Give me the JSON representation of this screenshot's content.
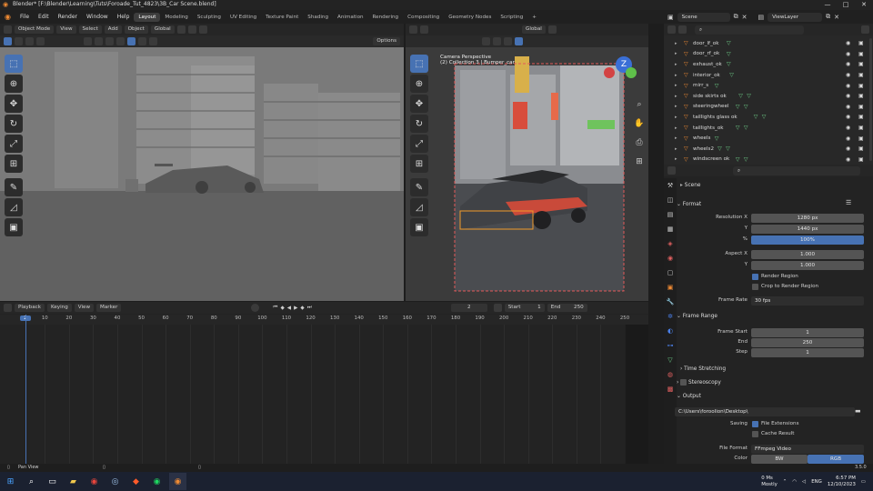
{
  "app": {
    "title": "Blender* [F:\\Blender\\Learning\\Tuts\\Foroade_Tut_4823\\3B_Car Scene.blend]",
    "window_controls": [
      "—",
      "□",
      "✕"
    ]
  },
  "menus": [
    "File",
    "Edit",
    "Render",
    "Window",
    "Help"
  ],
  "workspaces": [
    "Layout",
    "Modeling",
    "Sculpting",
    "UV Editing",
    "Texture Paint",
    "Shading",
    "Animation",
    "Rendering",
    "Compositing",
    "Geometry Nodes",
    "Scripting",
    "+"
  ],
  "scene_selector": {
    "label": "Scene",
    "view_layer": "ViewLayer"
  },
  "viewport_header_left": {
    "mode": "Object Mode",
    "menus": [
      "View",
      "Select",
      "Add",
      "Object"
    ],
    "transform": "Global",
    "options": "Options"
  },
  "viewport_header_right": {
    "transform": "Global"
  },
  "camera_overlay": {
    "line1": "Camera Perspective",
    "line2": "(2) Collection 3 | Bumper_car"
  },
  "outliner": {
    "items": [
      {
        "name": "door_lf_ok",
        "marked": false
      },
      {
        "name": "door_rf_ok",
        "marked": false
      },
      {
        "name": "exhaust_ok",
        "marked": false
      },
      {
        "name": "interior_ok",
        "marked": false
      },
      {
        "name": "mirr_s",
        "marked": false
      },
      {
        "name": "side skirts ok",
        "marked": true
      },
      {
        "name": "steeringwheel",
        "marked": true
      },
      {
        "name": "taillights glass ok",
        "marked": true
      },
      {
        "name": "taillights_ok",
        "marked": true
      },
      {
        "name": "wheels",
        "marked": false
      },
      {
        "name": "wheels2",
        "marked": true
      },
      {
        "name": "windscreen ok",
        "marked": true
      }
    ]
  },
  "properties": {
    "breadcrumb": "Scene",
    "format": {
      "title": "Format",
      "resolution_x_label": "Resolution X",
      "resolution_x": "1280 px",
      "y_label": "Y",
      "resolution_y": "1440 px",
      "pct_label": "%",
      "resolution_pct": "100%",
      "aspect_x_label": "Aspect X",
      "aspect_x": "1.000",
      "aspect_y_label": "Y",
      "aspect_y": "1.000",
      "render_region": "Render Region",
      "crop_to_render_region": "Crop to Render Region",
      "frame_rate_label": "Frame Rate",
      "frame_rate": "30 fps"
    },
    "frame_range": {
      "title": "Frame Range",
      "start_label": "Frame Start",
      "start": "1",
      "end_label": "End",
      "end": "250",
      "step_label": "Step",
      "step": "1"
    },
    "time_stretching": "Time Stretching",
    "stereoscopy": "Stereoscopy",
    "output": {
      "title": "Output",
      "path": "C:\\Users\\foroolion\\Desktop\\",
      "saving_label": "Saving",
      "file_extensions": "File Extensions",
      "cache_result": "Cache Result",
      "file_format_label": "File Format",
      "file_format": "FFmpeg Video",
      "color_label": "Color",
      "color_bw": "BW",
      "color_rgb": "RGB"
    }
  },
  "timeline": {
    "menus": [
      "Playback",
      "Keying",
      "View",
      "Marker"
    ],
    "current_frame": "2",
    "start_label": "Start",
    "start": "1",
    "end_label": "End",
    "end": "250",
    "ruler": [
      "2",
      "10",
      "20",
      "30",
      "40",
      "50",
      "60",
      "70",
      "80",
      "90",
      "100",
      "110",
      "120",
      "130",
      "140",
      "150",
      "160",
      "170",
      "180",
      "190",
      "200",
      "210",
      "220",
      "230",
      "240",
      "250"
    ]
  },
  "statusbar": {
    "left": "Pan View",
    "right": "3.5.0"
  },
  "taskbar": {
    "weather_temp": "0 Ms",
    "weather_desc": "Mostly",
    "lang": "ENG",
    "time": "6:57 PM",
    "date": "12/10/2023"
  },
  "colors": {
    "accent": "#4772b3",
    "orange": "#ef8a33",
    "green": "#6fd28a",
    "playhead": "#4772b3"
  }
}
